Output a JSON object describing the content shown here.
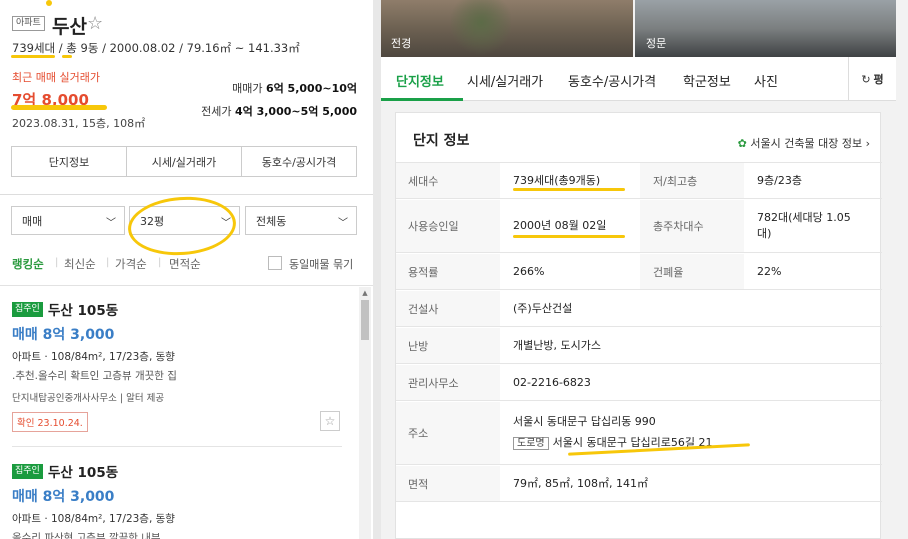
{
  "left": {
    "badge": "아파트",
    "name": "두산",
    "summary": "739세대 / 총 9동 / 2000.08.02 / 79.16㎡ ~ 141.33㎡",
    "recent_label": "최근 매매 실거래가",
    "recent_price": "7억 8,000",
    "recent_date": "2023.08.31, 15층, 108㎡",
    "sale_label": "매매가",
    "sale_range": "6억 5,000~10억",
    "rent_label": "전세가",
    "rent_range": "4억 3,000~5억 5,000",
    "tabs": [
      "단지정보",
      "시세/실거래가",
      "동호수/공시가격"
    ],
    "filters": {
      "trade": "매매",
      "size": "32평",
      "dong": "전체동"
    },
    "sorts": [
      "랭킹순",
      "최신순",
      "가격순",
      "면적순"
    ],
    "same_group_label": "동일매물 묶기",
    "listings": [
      {
        "badge": "집주인",
        "name": "두산 105동",
        "price": "매매 8억 3,000",
        "info": "아파트 · 108/84m², 17/23층, 동향",
        "desc": ".추천.올수리 확트인 고층뷰 개끗한 집",
        "agent": "단지내탑공인중개사사무소 | 알터 제공",
        "confirm": "확인 23.10.24."
      },
      {
        "badge": "집주인",
        "name": "두산 105동",
        "price": "매매 8억 3,000",
        "info": "아파트 · 108/84m², 17/23층, 동향",
        "desc": "올수리 파산형 고층뷰 깔끔한 내부"
      }
    ]
  },
  "right": {
    "photos": [
      "전경",
      "정문"
    ],
    "tabs": [
      "단지정보",
      "시세/실거래가",
      "동호수/공시가격",
      "학군정보",
      "사진"
    ],
    "pyeong_label": "평",
    "card_title": "단지 정보",
    "card_link": "서울시 건축물 대장 정보",
    "rows": [
      {
        "k1": "세대수",
        "v1": "739세대(총9개동)",
        "k2": "저/최고층",
        "v2": "9층/23층"
      },
      {
        "k1": "사용승인일",
        "v1": "2000년 08월 02일",
        "k2": "총주차대수",
        "v2": "782대(세대당 1.05대)"
      },
      {
        "k1": "용적률",
        "v1": "266%",
        "k2": "건폐율",
        "v2": "22%"
      },
      {
        "k1": "건설사",
        "v1": "(주)두산건설"
      },
      {
        "k1": "난방",
        "v1": "개별난방, 도시가스"
      },
      {
        "k1": "관리사무소",
        "v1": "02-2216-6823"
      },
      {
        "k1": "주소",
        "v1": "서울시 동대문구 답십리동 990",
        "road_tag": "도로명",
        "road": "서울시 동대문구 답십리로56길 21"
      },
      {
        "k1": "면적",
        "v1": "79㎡, 85㎡, 108㎡, 141㎡"
      }
    ]
  },
  "colors": {
    "accent_green": "#1aa048",
    "price_red": "#e54c2f",
    "price_blue": "#3a7ec6",
    "highlight": "#f7c70a"
  }
}
